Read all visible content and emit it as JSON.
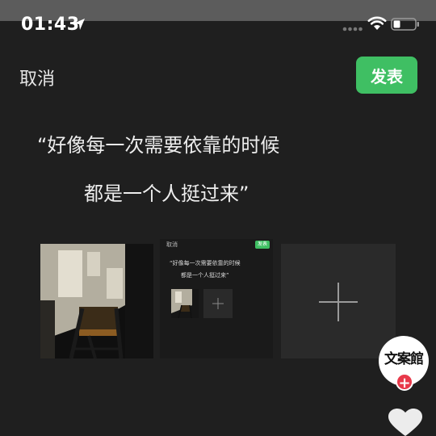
{
  "status_bar": {
    "time": "01:43"
  },
  "header": {
    "cancel_label": "取消",
    "publish_label": "发表"
  },
  "post": {
    "quote_line1": "“好像每一次需要依靠的时候",
    "quote_line2": "都是一个人挺过来”"
  },
  "mini_preview": {
    "cancel_label": "取消",
    "publish_label": "发表",
    "quote_line1": "“好像每一次需要依靠的时候",
    "quote_line2": "都是一个人挺过来”"
  },
  "floating": {
    "logo_text": "文案館"
  },
  "icons": {
    "location": "location-arrow-icon",
    "signal": "signal-dots-icon",
    "wifi": "wifi-icon",
    "battery": "battery-icon",
    "add": "plus-icon",
    "heart": "heart-icon"
  },
  "colors": {
    "background": "#1f1f1f",
    "accent": "#3fbf63",
    "badge": "#e8394a"
  }
}
